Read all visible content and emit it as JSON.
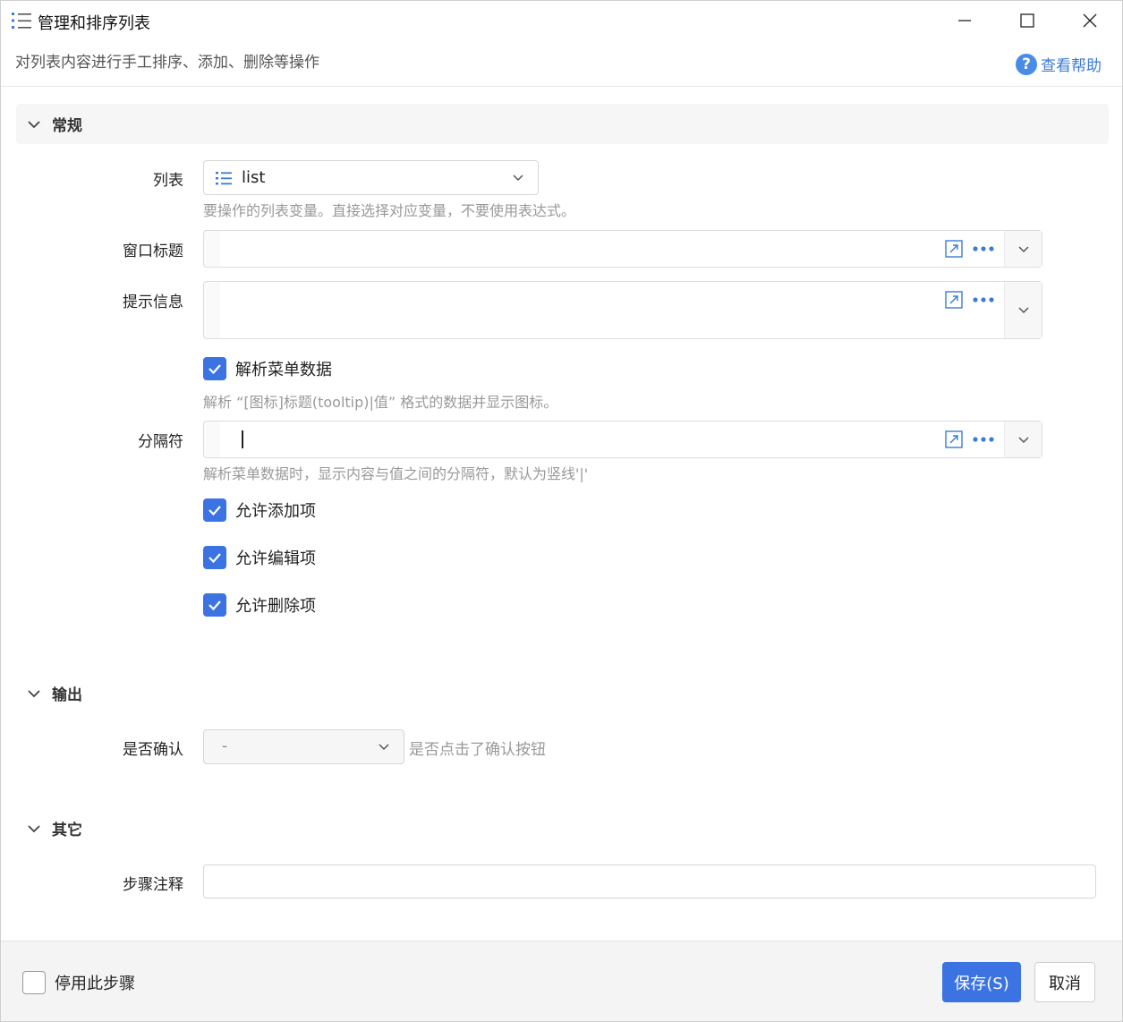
{
  "window": {
    "title": "管理和排序列表",
    "subtitle": "对列表内容进行手工排序、添加、删除等操作",
    "help_label": "查看帮助"
  },
  "sections": {
    "general": "常规",
    "output": "输出",
    "other": "其它"
  },
  "fields": {
    "list": {
      "label": "列表",
      "value": "list",
      "hint": "要操作的列表变量。直接选择对应变量，不要使用表达式。"
    },
    "window_title": {
      "label": "窗口标题",
      "value": ""
    },
    "prompt": {
      "label": "提示信息",
      "value": ""
    },
    "parse_menu": {
      "label": "解析菜单数据",
      "checked": true,
      "hint": "解析 “[图标]标题(tooltip)|值” 格式的数据并显示图标。"
    },
    "separator": {
      "label": "分隔符",
      "value": "",
      "hint": "解析菜单数据时，显示内容与值之间的分隔符，默认为竖线'|'"
    },
    "allow_add": {
      "label": "允许添加项",
      "checked": true
    },
    "allow_edit": {
      "label": "允许编辑项",
      "checked": true
    },
    "allow_delete": {
      "label": "允许删除项",
      "checked": true
    },
    "confirmed": {
      "label": "是否确认",
      "value": "-",
      "hint": "是否点击了确认按钮"
    },
    "step_note": {
      "label": "步骤注释",
      "value": ""
    }
  },
  "footer": {
    "disable_step_label": "停用此步骤",
    "disable_step_checked": false,
    "save_label": "保存(S)",
    "cancel_label": "取消"
  },
  "colors": {
    "accent": "#3b73e3",
    "link": "#3a7bd5",
    "hint": "#999999"
  }
}
